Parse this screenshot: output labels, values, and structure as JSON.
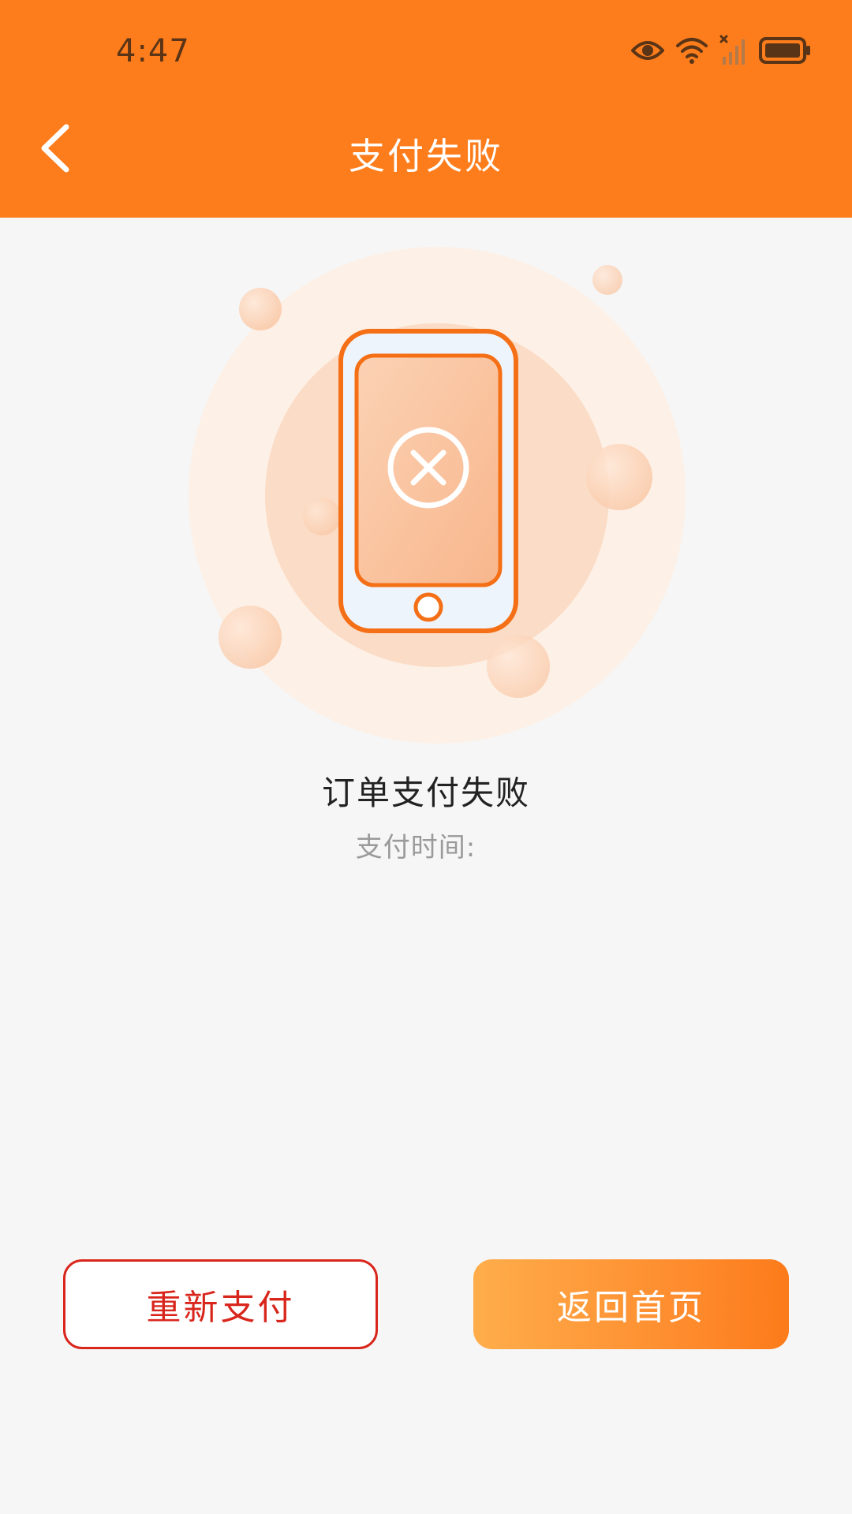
{
  "status_bar": {
    "time": "4:47",
    "icons": [
      "eye-icon",
      "wifi-icon",
      "signal-icon",
      "battery-icon"
    ]
  },
  "header": {
    "title": "支付失败",
    "back_icon": "chevron-left-icon",
    "background_color": "#fd7d1c"
  },
  "illustration": {
    "icon": "payment-failed-phone-icon",
    "status_icon": "close-circle-icon",
    "accent_color": "#f46f16"
  },
  "message": {
    "title": "订单支付失败",
    "subtitle": "支付时间:"
  },
  "actions": {
    "retry_label": "重新支付",
    "home_label": "返回首页",
    "retry_color": "#d9261c"
  }
}
